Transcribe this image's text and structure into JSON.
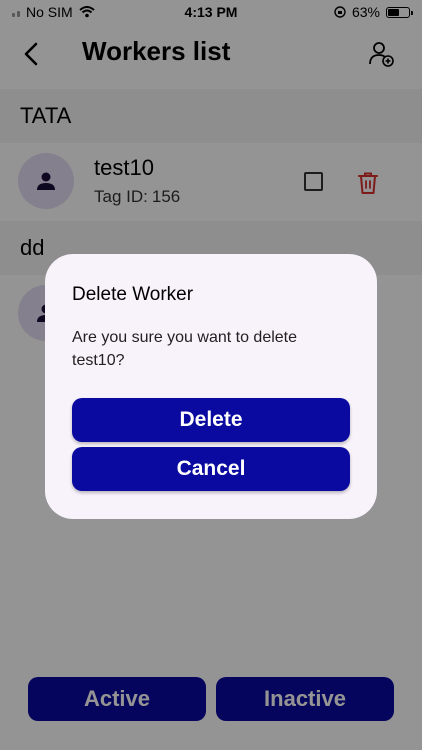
{
  "status_bar": {
    "carrier": "No SIM",
    "time": "4:13 PM",
    "battery": "63%",
    "battery_level": 0.63,
    "icons": [
      "signal-icon",
      "wifi-icon",
      "orientation-lock-icon",
      "battery-icon"
    ]
  },
  "header": {
    "title": "Workers list",
    "back_icon": "chevron-left-icon",
    "add_icon": "add-user-icon"
  },
  "groups": [
    {
      "name": "TATA",
      "workers": [
        {
          "name": "test10",
          "tag_label": "Tag ID:",
          "tag_id": "156"
        }
      ]
    },
    {
      "name": "dd",
      "workers": [
        {
          "name": "",
          "tag_label": "",
          "tag_id": ""
        }
      ]
    }
  ],
  "dialog": {
    "title": "Delete Worker",
    "message": "Are you sure you want to delete test10?",
    "confirm_label": "Delete",
    "cancel_label": "Cancel"
  },
  "footer": {
    "active_label": "Active",
    "inactive_label": "Inactive"
  },
  "colors": {
    "primary": "#0a0aa0",
    "dialog_bg": "#f8f2fb",
    "avatar_bg": "#e6dcf5",
    "trash": "#d83030",
    "overlay": "rgba(0,0,0,0.42)"
  }
}
